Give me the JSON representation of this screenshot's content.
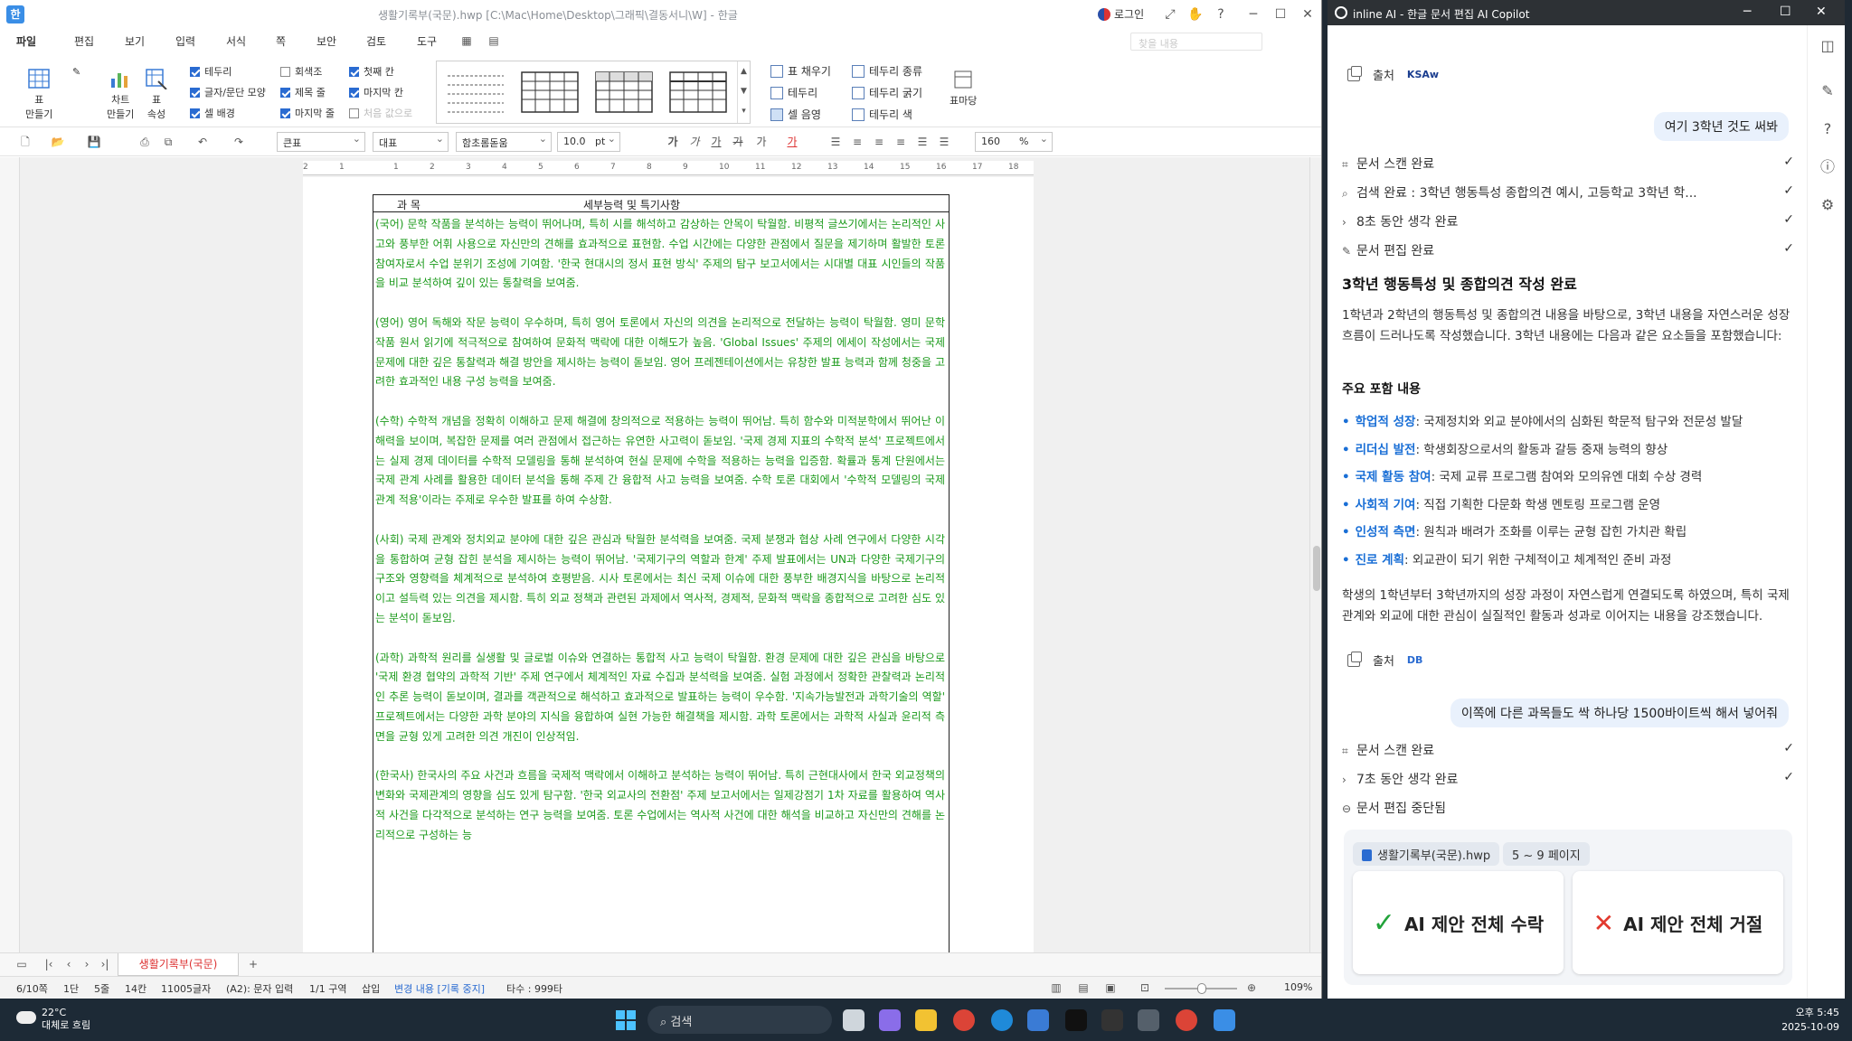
{
  "hwp": {
    "title": "생활기록부(국문).hwp [C:\\Mac\\Home\\Desktop\\그래픽\\결동서니\\W] - 한글",
    "login": "로그인",
    "menu": [
      "파일",
      "편집",
      "보기",
      "입력",
      "서식",
      "쪽",
      "보안",
      "검토",
      "도구"
    ],
    "search_placeholder": "찾을 내용",
    "ribbon": {
      "table_make": "표\n만들기",
      "chart_make": "차트\n만들기",
      "table_props": "표\n속성",
      "checks": [
        {
          "label": "테두리",
          "on": true
        },
        {
          "label": "글자/문단 모양",
          "on": true
        },
        {
          "label": "셀 배경",
          "on": true
        },
        {
          "label": "회색조",
          "on": false
        },
        {
          "label": "제목 줄",
          "on": true
        },
        {
          "label": "마지막 줄",
          "on": true
        },
        {
          "label": "첫째 칸",
          "on": true
        },
        {
          "label": "마지막 칸",
          "on": true
        },
        {
          "label": "처음 값으로",
          "on": false
        }
      ],
      "fill": "표 채우기",
      "border": "테두리",
      "cell_color": "셀 음영",
      "border_type": "테두리 종류",
      "border_width": "테두리 굵기",
      "border_color": "테두리 색",
      "table_margin": "표마당"
    },
    "toolbar2": {
      "style": "큰표",
      "paragraph": "대표",
      "font": "함초롬돋움",
      "size": "10.0",
      "unit": "pt",
      "zoom": "160",
      "zoom_unit": "%"
    },
    "ruler": [
      "2",
      "1",
      "1",
      "2",
      "3",
      "4",
      "5",
      "6",
      "7",
      "8",
      "9",
      "10",
      "11",
      "12",
      "13",
      "14",
      "15",
      "16",
      "17",
      "18"
    ],
    "table_header": {
      "col1": "과  목",
      "col2": "세부능력 및 특기사항"
    },
    "paragraphs": [
      "(국어) 문학 작품을 분석하는 능력이 뛰어나며, 특히 시를 해석하고 감상하는 안목이 탁월함. 비평적 글쓰기에서는 논리적인 사고와 풍부한 어휘 사용으로 자신만의 견해를 효과적으로 표현함. 수업 시간에는 다양한 관점에서 질문을 제기하며 활발한 토론 참여자로서 수업 분위기 조성에 기여함. '한국 현대시의 정서 표현 방식' 주제의 탐구 보고서에서는 시대별 대표 시인들의 작품을 비교 분석하여 깊이 있는 통찰력을 보여줌.",
      "(영어) 영어 독해와 작문 능력이 우수하며, 특히 영어 토론에서 자신의 의견을 논리적으로 전달하는 능력이 탁월함. 영미 문학 작품 원서 읽기에 적극적으로 참여하여 문화적 맥락에 대한 이해도가 높음. 'Global Issues' 주제의 에세이 작성에서는 국제 문제에 대한 깊은 통찰력과 해결 방안을 제시하는 능력이 돋보임. 영어 프레젠테이션에서는 유창한 발표 능력과 함께 청중을 고려한 효과적인 내용 구성 능력을 보여줌.",
      "(수학) 수학적 개념을 정확히 이해하고 문제 해결에 창의적으로 적용하는 능력이 뛰어남. 특히 함수와 미적분학에서 뛰어난 이해력을 보이며, 복잡한 문제를 여러 관점에서 접근하는 유연한 사고력이 돋보임. '국제 경제 지표의 수학적 분석' 프로젝트에서는 실제 경제 데이터를 수학적 모델링을 통해 분석하여 현실 문제에 수학을 적용하는 능력을 입증함. 확률과 통계 단원에서는 국제 관계 사례를 활용한 데이터 분석을 통해 주제 간 융합적 사고 능력을 보여줌. 수학 토론 대회에서 '수학적 모델링의 국제 관계 적용'이라는 주제로 우수한 발표를 하여 수상함.",
      "(사회) 국제 관계와 정치외교 분야에 대한 깊은 관심과 탁월한 분석력을 보여줌. 국제 분쟁과 협상 사례 연구에서 다양한 시각을 통합하여 균형 잡힌 분석을 제시하는 능력이 뛰어남. '국제기구의 역할과 한계' 주제 발표에서는 UN과 다양한 국제기구의 구조와 영향력을 체계적으로 분석하여 호평받음. 시사 토론에서는 최신 국제 이슈에 대한 풍부한 배경지식을 바탕으로 논리적이고 설득력 있는 의견을 제시함. 특히 외교 정책과 관련된 과제에서 역사적, 경제적, 문화적 맥락을 종합적으로 고려한 심도 있는 분석이 돋보임.",
      "(과학) 과학적 원리를 실생활 및 글로벌 이슈와 연결하는 통합적 사고 능력이 탁월함. 환경 문제에 대한 깊은 관심을 바탕으로 '국제 환경 협약의 과학적 기반' 주제 연구에서 체계적인 자료 수집과 분석력을 보여줌. 실험 과정에서 정확한 관찰력과 논리적인 추론 능력이 돋보이며, 결과를 객관적으로 해석하고 효과적으로 발표하는 능력이 우수함. '지속가능발전과 과학기술의 역할' 프로젝트에서는 다양한 과학 분야의 지식을 융합하여 실현 가능한 해결책을 제시함. 과학 토론에서는 과학적 사실과 윤리적 측면을 균형 있게 고려한 의견 개진이 인상적임.",
      "(한국사) 한국사의 주요 사건과 흐름을 국제적 맥락에서 이해하고 분석하는 능력이 뛰어남. 특히 근현대사에서 한국 외교정책의 변화와 국제관계의 영향을 심도 있게 탐구함. '한국 외교사의 전환점' 주제 보고서에서는 일제강점기 1차 자료를 활용하여 역사적 사건을 다각적으로 분석하는 연구 능력을 보여줌. 토론 수업에서는 역사적 사건에 대한 해석을 비교하고 자신만의 견해를 논리적으로 구성하는 능"
    ],
    "tab_name": "생활기록부(국문)",
    "status": {
      "page": "6/10쪽",
      "col": "1단",
      "line": "5줄",
      "char": "14칸",
      "count": "11005글자",
      "mode": "(A2): 문자 입력",
      "section": "1/1 구역",
      "insert": "삽입",
      "track": "변경 내용 [기록 중지]",
      "keys": "타수 : 999타",
      "zoom": "109%"
    }
  },
  "ai": {
    "title": "inline AI - 한글 문서 편집 AI Copilot",
    "source_label": "출처",
    "source_logo_1": "KSAw",
    "source_logo_2": "DB",
    "user_msg_1": "여기 3학년 것도 써봐",
    "steps_1": [
      {
        "icon": "scan-icon",
        "text": "문서 스캔 완료"
      },
      {
        "icon": "search-icon",
        "text": "검색 완료 : 3학년 행동특성 종합의견 예시, 고등학교 3학년 학..."
      },
      {
        "icon": "chevron-right-icon",
        "text": "8초 동안 생각 완료"
      },
      {
        "icon": "edit-icon",
        "text": "문서 편집 완료"
      }
    ],
    "heading": "3학년 행동특성 및 종합의견 작성 완료",
    "intro": "1학년과 2학년의 행동특성 및 종합의견 내용을 바탕으로, 3학년 내용을 자연스러운 성장 흐름이 드러나도록 작성했습니다. 3학년 내용에는 다음과 같은 요소들을 포함했습니다:",
    "subheading": "주요 포함 내용",
    "bullets": [
      {
        "key": "학업적 성장",
        "text": ": 국제정치와 외교 분야에서의 심화된 학문적 탐구와 전문성 발달"
      },
      {
        "key": "리더십 발전",
        "text": ": 학생회장으로서의 활동과 갈등 중재 능력의 향상"
      },
      {
        "key": "국제 활동 참여",
        "text": ": 국제 교류 프로그램 참여와 모의유엔 대회 수상 경력"
      },
      {
        "key": "사회적 기여",
        "text": ": 직접 기획한 다문화 학생 멘토링 프로그램 운영"
      },
      {
        "key": "인성적 측면",
        "text": ": 원칙과 배려가 조화를 이루는 균형 잡힌 가치관 확립"
      },
      {
        "key": "진로 계획",
        "text": ": 외교관이 되기 위한 구체적이고 체계적인 준비 과정"
      }
    ],
    "summary": "학생의 1학년부터 3학년까지의 성장 과정이 자연스럽게 연결되도록 하였으며, 특히 국제 관계와 외교에 대한 관심이 실질적인 활동과 성과로 이어지는 내용을 강조했습니다.",
    "user_msg_2": "이쪽에 다른 과목들도 싹 하나당 1500바이트씩 해서 넣어줘",
    "steps_2": [
      {
        "icon": "scan-icon",
        "text": "문서 스캔 완료",
        "ok": true
      },
      {
        "icon": "chevron-right-icon",
        "text": "7초 동안 생각 완료",
        "ok": true
      },
      {
        "icon": "stop-icon",
        "text": "문서 편집 중단됨",
        "ok": false
      }
    ],
    "file_chip": "생활기록부(국문).hwp",
    "page_chip": "5 ~ 9 페이지",
    "accept_all": "AI 제안 전체 수락",
    "reject_all": "AI 제안 전체 거절"
  },
  "taskbar": {
    "temp": "22°C",
    "weather": "대체로 흐림",
    "search": "검색",
    "time": "오후 5:45",
    "date": "2025-10-09"
  },
  "colors": {
    "doc_text": "#1b9a1b",
    "accent": "#1a6fd6",
    "accept": "#22a33a",
    "reject": "#e23a2f"
  }
}
